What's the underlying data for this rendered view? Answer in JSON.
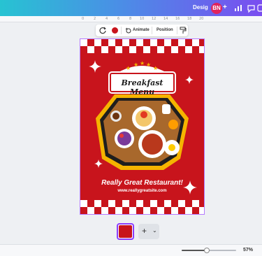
{
  "topbar": {
    "design_label": "Desig",
    "avatar_initials": "BN",
    "plus": "+",
    "icons": [
      "chart-icon",
      "comment-icon",
      "share-icon"
    ]
  },
  "ruler": {
    "ticks": [
      "0",
      "2",
      "4",
      "6",
      "8",
      "10",
      "12",
      "14",
      "16",
      "18",
      "20"
    ]
  },
  "toolbar": {
    "animate_label": "Animate",
    "position_label": "Position",
    "text_color": "#c8141c"
  },
  "canvas": {
    "title": "Breakfast Menu",
    "tagline": "Really Great Restaurant!",
    "url": "www.reallygreatsite.com",
    "colors": {
      "primary": "#c8141c",
      "accent": "#f5b400",
      "white": "#ffffff"
    }
  },
  "pages": {
    "add_label": "+",
    "chevron": "⌄"
  },
  "zoom": {
    "value": "57%",
    "level_fraction": 0.46
  },
  "colors": {
    "selection": "#b57bff",
    "brand_purple": "#8b3dff"
  }
}
